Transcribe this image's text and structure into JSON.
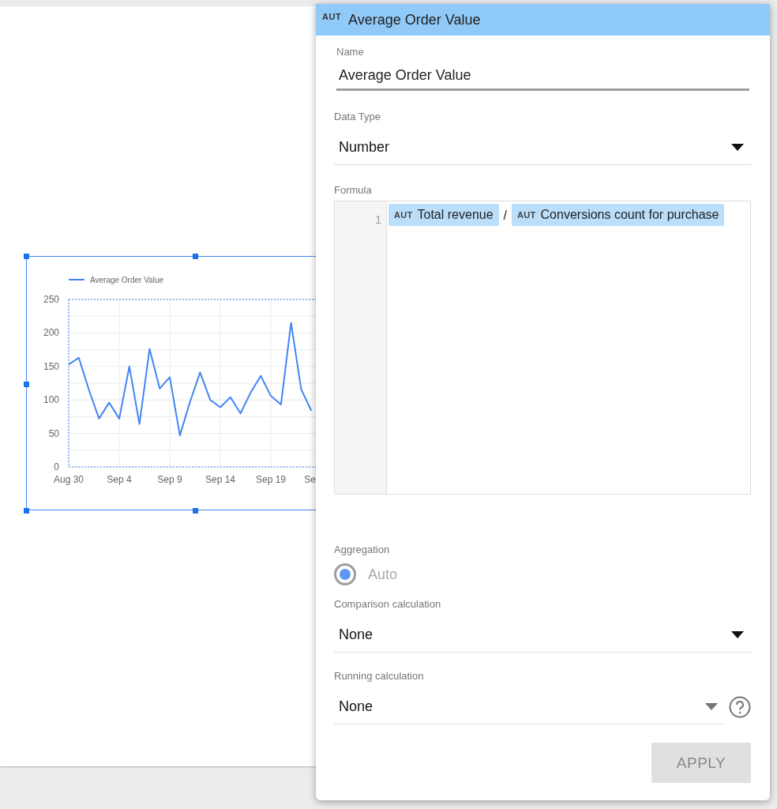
{
  "report_canvas": {
    "chart_widget": {
      "clipped_axis_label": "Se",
      "chart_data": {
        "type": "line",
        "grid": true,
        "categories": [
          "Aug 30",
          null,
          null,
          null,
          null,
          "Sep 4",
          null,
          null,
          null,
          null,
          "Sep 9",
          null,
          null,
          null,
          null,
          "Sep 14",
          null,
          null,
          null,
          null,
          "Sep 19",
          null,
          null,
          null,
          null
        ],
        "series": [
          {
            "name": "Average Order Value",
            "color": "#4285f4",
            "values": [
              153,
              163,
              115,
              72,
              96,
              72,
              150,
              64,
              176,
              117,
              134,
              47,
              97,
              141,
              100,
              89,
              104,
              80,
              111,
              136,
              106,
              93,
              215,
              116,
              84
            ]
          }
        ],
        "ylim": [
          0,
          250
        ],
        "yticks": [
          0,
          50,
          100,
          150,
          200,
          250
        ]
      }
    }
  },
  "field_panel": {
    "header": {
      "badge": "AUT",
      "title": "Average Order Value"
    },
    "name": {
      "label": "Name",
      "value": "Average Order Value"
    },
    "data_type": {
      "label": "Data Type",
      "value": "Number"
    },
    "formula": {
      "label": "Formula",
      "line_numbers": [
        "1"
      ],
      "tokens": [
        {
          "kind": "field",
          "badge": "AUT",
          "text": "Total revenue"
        },
        {
          "kind": "operator",
          "text": "/"
        },
        {
          "kind": "field",
          "badge": "AUT",
          "text": "Conversions count for purchase"
        }
      ]
    },
    "aggregation": {
      "label": "Aggregation",
      "options": [
        {
          "label": "Auto",
          "selected": true,
          "disabled": true
        }
      ]
    },
    "comparison_calculation": {
      "label": "Comparison calculation",
      "value": "None"
    },
    "running_calculation": {
      "label": "Running calculation",
      "value": "None",
      "help": true
    },
    "apply_button": {
      "label": "APPLY",
      "disabled": true
    }
  }
}
